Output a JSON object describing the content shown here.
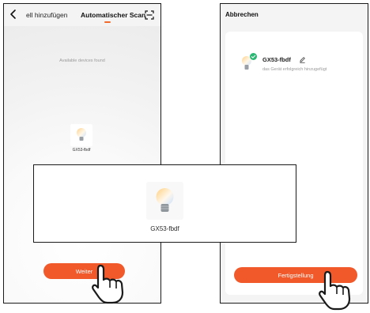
{
  "left_screen": {
    "tab_manual_label": "ell hinzufügen",
    "tab_auto_label": "Automatischer Scan",
    "status_text": "Available devices found",
    "device_name": "GX53-fbdf",
    "next_button": "Weiter",
    "accent_color": "#f2592a"
  },
  "zoom_callout": {
    "device_name": "GX53-fbdf"
  },
  "right_screen": {
    "cancel_label": "Abbrechen",
    "device_name": "GX53-fbdf",
    "device_status": "das Gerät erfolgreich hinzugefügt",
    "finish_button": "Fertigstellung",
    "success_color": "#2ab673"
  },
  "icons": [
    "back-arrow-icon",
    "scan-frame-icon",
    "light-bulb-icon",
    "check-badge-icon",
    "edit-pencil-icon",
    "tap-hand-icon"
  ]
}
